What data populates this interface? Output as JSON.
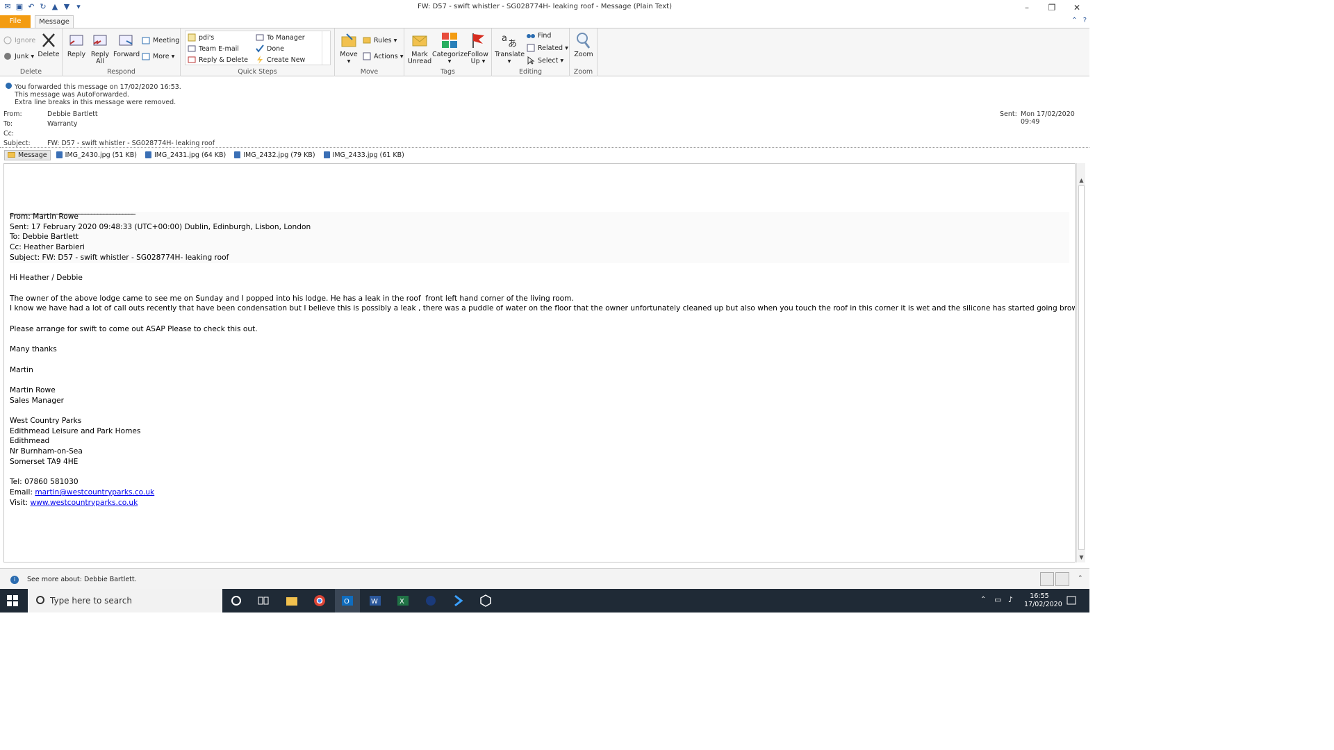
{
  "window": {
    "title": "FW: D57 - swift whistler - SG028774H- leaking roof  -  Message (Plain Text)",
    "minimize": "–",
    "restore": "❐",
    "close": "✕"
  },
  "tabs": {
    "file": "File",
    "message": "Message"
  },
  "ribbon": {
    "delete_group": {
      "label": "Delete",
      "ignore": "Ignore",
      "junk": "Junk",
      "delete": "Delete"
    },
    "respond_group": {
      "label": "Respond",
      "reply": "Reply",
      "reply_all_line1": "Reply",
      "reply_all_line2": "All",
      "forward": "Forward",
      "meeting": "Meeting",
      "more": "More"
    },
    "quicksteps_group": {
      "label": "Quick Steps",
      "items": [
        "pdi's",
        "Team E-mail",
        "Reply & Delete",
        "To Manager",
        "Done",
        "Create New"
      ]
    },
    "move_group": {
      "label": "Move",
      "move": "Move",
      "rules": "Rules",
      "actions": "Actions"
    },
    "tags_group": {
      "label": "Tags",
      "mark_unread_line1": "Mark",
      "mark_unread_line2": "Unread",
      "categorize": "Categorize",
      "follow_up_line1": "Follow",
      "follow_up_line2": "Up"
    },
    "editing_group": {
      "label": "Editing",
      "translate": "Translate",
      "find": "Find",
      "related": "Related",
      "select": "Select"
    },
    "zoom_group": {
      "label": "Zoom",
      "zoom": "Zoom"
    }
  },
  "infobar": {
    "line1": "You forwarded this message on 17/02/2020 16:53.",
    "line2": "This message was AutoForwarded.",
    "line3": "Extra line breaks in this message were removed."
  },
  "headers": {
    "from_label": "From:",
    "from": "Debbie Bartlett",
    "to_label": "To:",
    "to": "Warranty",
    "cc_label": "Cc:",
    "cc": "",
    "subject_label": "Subject:",
    "subject": "FW: D57 - swift whistler - SG028774H- leaking roof",
    "sent_label": "Sent:",
    "sent": "Mon 17/02/2020 09:49"
  },
  "attachments": {
    "message_tab": "Message",
    "files": [
      "IMG_2430.jpg (51 KB)",
      "IMG_2431.jpg (64 KB)",
      "IMG_2432.jpg (79 KB)",
      "IMG_2433.jpg (61 KB)"
    ]
  },
  "body": {
    "separator": "________________________________________",
    "quoted_from": "From: Martin Rowe",
    "quoted_sent": "Sent: 17 February 2020 09:48:33 (UTC+00:00) Dublin, Edinburgh, Lisbon, London",
    "quoted_to": "To: Debbie Bartlett",
    "quoted_cc": "Cc: Heather Barbieri",
    "quoted_subject": "Subject: FW: D57 - swift whistler - SG028774H- leaking roof",
    "greeting": "Hi Heather / Debbie",
    "para1": "The owner of the above lodge came to see me on Sunday and I popped into his lodge. He has a leak in the roof  front left hand corner of the living room.",
    "para2": "I know we have had a lot of call outs recently that have been condensation but I believe this is possibly a leak , there was a puddle of water on the floor that the owner unfortunately cleaned up but also when you touch the roof in this corner it is wet and the silicone has started going brown.",
    "para3": "Please arrange for swift to come out ASAP Please to check this out.",
    "thanks": "Many thanks",
    "signoff": "Martin",
    "sig_name": "Martin Rowe",
    "sig_title": "Sales Manager",
    "company": "West Country Parks",
    "addr1": "Edithmead Leisure and Park Homes",
    "addr2": "Edithmead",
    "addr3": "Nr Burnham-on-Sea",
    "addr4": "Somerset TA9 4HE",
    "tel": "Tel: 07860 581030",
    "email_label": "Email: ",
    "email": "martin@westcountryparks.co.uk",
    "visit_label": "Visit: ",
    "visit": "www.westcountryparks.co.uk"
  },
  "people_pane": {
    "text": "See more about: Debbie Bartlett."
  },
  "taskbar": {
    "search_placeholder": "Type here to search",
    "time": "16:55",
    "date": "17/02/2020"
  }
}
